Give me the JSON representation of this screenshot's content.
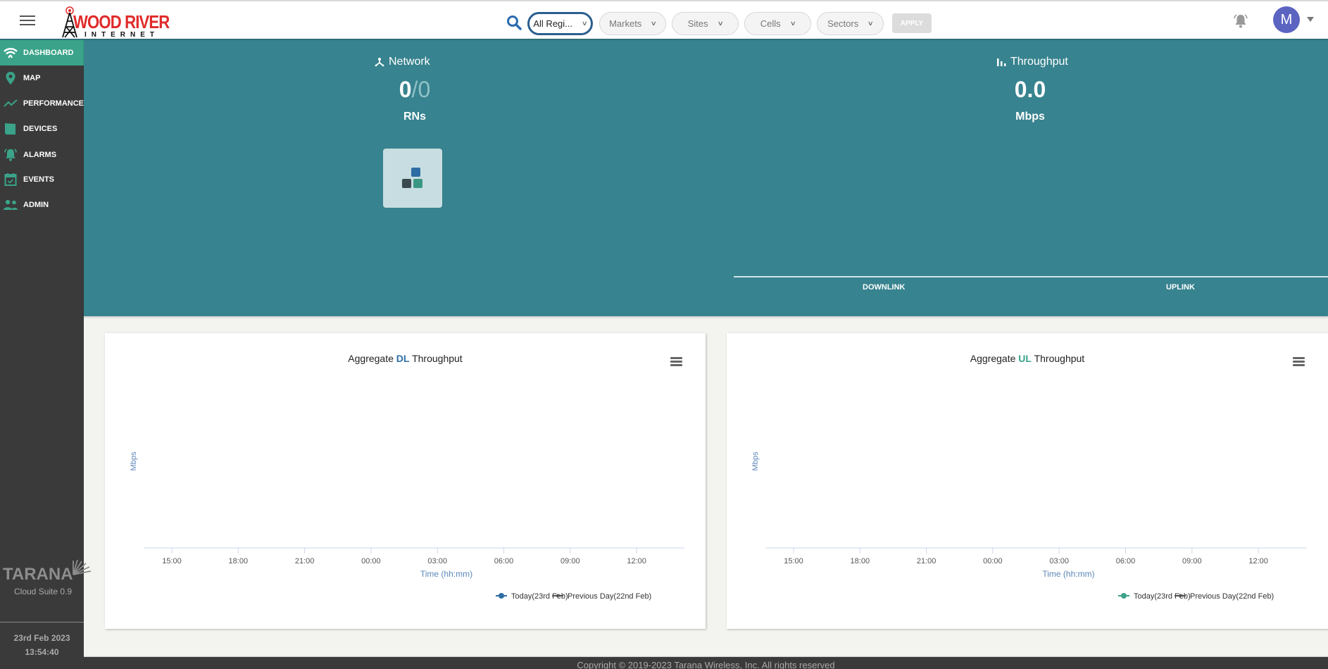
{
  "topbar": {
    "logo_title": "WOOD RIVER",
    "logo_sub": "INTERNET",
    "filters": [
      {
        "label": "All Regi...",
        "active": true
      },
      {
        "label": "Markets",
        "active": false
      },
      {
        "label": "Sites",
        "active": false
      },
      {
        "label": "Cells",
        "active": false
      },
      {
        "label": "Sectors",
        "active": false
      }
    ],
    "apply_label": "APPLY",
    "avatar_initial": "M"
  },
  "sidebar": {
    "items": [
      {
        "label": "DASHBOARD",
        "icon": "wifi-icon",
        "active": true
      },
      {
        "label": "MAP",
        "icon": "map-pin-icon",
        "active": false
      },
      {
        "label": "PERFORMANCE",
        "icon": "trend-line-icon",
        "active": false
      },
      {
        "label": "DEVICES",
        "icon": "device-icon",
        "active": false
      },
      {
        "label": "ALARMS",
        "icon": "alarm-bell-icon",
        "active": false
      },
      {
        "label": "EVENTS",
        "icon": "calendar-check-icon",
        "active": false
      },
      {
        "label": "ADMIN",
        "icon": "users-icon",
        "active": false
      }
    ],
    "brand": "TARANA",
    "version": "Cloud Suite 0.9",
    "date": "23rd Feb 2023",
    "time": "13:54:40"
  },
  "summary": {
    "network": {
      "title": "Network",
      "up": "0",
      "total": "/0",
      "unit": "RNs"
    },
    "throughput": {
      "title": "Throughput",
      "value": "0.0",
      "unit": "Mbps",
      "tabs": [
        "DOWNLINK",
        "UPLINK"
      ]
    }
  },
  "chart_data": [
    {
      "type": "line",
      "title_prefix": "Aggregate ",
      "title_highlight": "DL",
      "title_suffix": " Throughput",
      "highlight_color": "#2e6da4",
      "xlabel": "Time (hh:mm)",
      "ylabel": "Mbps",
      "x_ticks": [
        "15:00",
        "18:00",
        "21:00",
        "00:00",
        "03:00",
        "06:00",
        "09:00",
        "12:00"
      ],
      "series": [
        {
          "name": "Today(23rd Feb)",
          "color": "#2e6da4",
          "values": []
        },
        {
          "name": "Previous Day(22nd Feb)",
          "color": "#555555",
          "values": []
        }
      ],
      "grid": false,
      "legend": "bottom-right"
    },
    {
      "type": "line",
      "title_prefix": "Aggregate ",
      "title_highlight": "UL",
      "title_suffix": " Throughput",
      "highlight_color": "#3aa389",
      "xlabel": "Time (hh:mm)",
      "ylabel": "Mbps",
      "x_ticks": [
        "15:00",
        "18:00",
        "21:00",
        "00:00",
        "03:00",
        "06:00",
        "09:00",
        "12:00"
      ],
      "series": [
        {
          "name": "Today(23rd Feb)",
          "color": "#3aa389",
          "values": []
        },
        {
          "name": "Previous Day(22nd Feb)",
          "color": "#555555",
          "values": []
        }
      ],
      "grid": false,
      "legend": "bottom-right"
    }
  ],
  "footer": {
    "copyright": "Copyright © 2019-2023 Tarana Wireless, Inc. All rights reserved"
  }
}
